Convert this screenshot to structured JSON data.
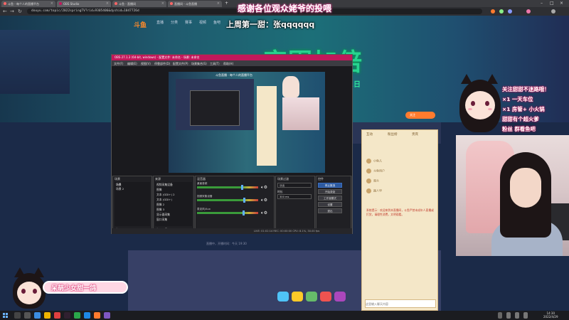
{
  "browser": {
    "tabs": [
      {
        "label": "斗鱼 - 每个人的直播平台"
      },
      {
        "label": "OBS Studio"
      },
      {
        "label": "斗鱼 - 直播间"
      },
      {
        "label": "直播间 - 斗鱼直播"
      }
    ],
    "url": "douyu.com/topic/2022springTV?rid=9305406&dyshid=1047726d"
  },
  "overlay": {
    "title": "感谢各位观众姥爷的投喂",
    "weekly_top": "上周第一甜：张qqqqqq"
  },
  "site": {
    "logo": "斗鱼",
    "nav": [
      "直播",
      "分类",
      "赛事",
      "视频",
      "鱼吧"
    ],
    "banner_title": "突围加倍",
    "banner_date": "1日",
    "subscribe_label": "关注",
    "chat_tabs": [
      "互动",
      "粉丝榜",
      "贵宾"
    ],
    "chat_users": [
      "小鱼儿",
      "斗鱼用户",
      "观众",
      "路人甲"
    ],
    "chat_notice": "系统提示：欢迎来到本直播间，斗鱼严禁未成年人直播或打赏，请理性消费，文明观看。",
    "room_text": "直播中，开播时间：今天 19:30",
    "chat_input_placeholder": "这里输入聊天内容"
  },
  "obs": {
    "title": "OBS 27.1.3 (64-bit, windows) - 配置文件: 未命名 - 场景: 未命名",
    "menu": [
      "文件(F)",
      "编辑(E)",
      "视图(V)",
      "停靠部件(D)",
      "配置文件(P)",
      "场景集合(S)",
      "工具(T)",
      "帮助(H)"
    ],
    "preview_title": "斗鱼直播 - 每个人的直播平台",
    "docks": {
      "scenes": {
        "title": "场景",
        "items": [
          "场景",
          "场景 2"
        ]
      },
      "sources": {
        "title": "来源",
        "items": [
          "视频采集设备",
          "图像",
          "文本 (GDI+) 2",
          "文本 (GDI+)",
          "图像 2",
          "图像 3",
          "显示器采集",
          "窗口采集"
        ]
      },
      "mixer": {
        "title": "混音器",
        "channels": [
          {
            "name": "桌面音频",
            "level": 0.72
          },
          {
            "name": "视频采集设备",
            "level": 0.75
          },
          {
            "name": "麦克风/Aux",
            "level": 0.74
          }
        ]
      },
      "transitions": {
        "title": "场景过渡",
        "type": "淡出",
        "duration_label": "时长",
        "duration": "300 ms"
      },
      "controls": {
        "title": "控件",
        "buttons": [
          "停止推流",
          "开始录制",
          "工作室模式",
          "设置",
          "退出"
        ]
      }
    },
    "status": "LIVE: 01:02:14   REC: 00:00:00   CPU: 8.1%, 30.00 fps"
  },
  "notice": {
    "lines": [
      "关注甜甜不迷路哦！",
      "×1 一天车位",
      "×1 房管+ 小火锅",
      "甜甜有个超火爹",
      "粉丝 群看鱼吧"
    ]
  },
  "name_plate": "呆萌少女甜一鸽",
  "taskbar": {
    "time": "14:30",
    "date": "2022/4/29"
  },
  "colors": {
    "accent_pink": "#c2185b",
    "douyu_orange": "#ff7b2e",
    "banner_green": "#27d38f"
  }
}
